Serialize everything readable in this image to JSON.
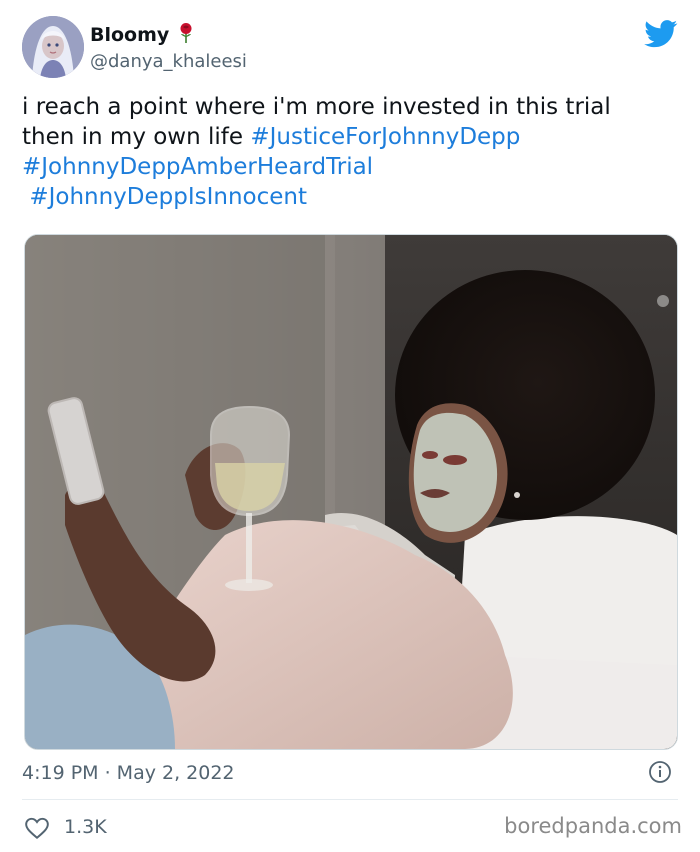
{
  "tweet": {
    "display_name": "Bloomy",
    "handle": "@danya_khaleesi",
    "text_lines": [
      {
        "plain": "i reach a point where i'm more invested in this trial",
        "tag": ""
      },
      {
        "plain": "then in my own life ",
        "tag": "#JusticeForJohnnyDepp"
      },
      {
        "plain": "",
        "tag": "#JohnnyDeppAmberHeardTrial"
      },
      {
        "plain": " ",
        "tag": "#JohnnyDeppIsInnocent"
      }
    ],
    "timestamp": "4:19 PM · May 2, 2022",
    "likes": "1.3K"
  },
  "branding": {
    "watermark": "boredpanda.com"
  },
  "icons": {
    "twitter": "twitter-bird-icon",
    "info": "info-icon",
    "like": "heart-icon",
    "emoji": "rose-icon"
  },
  "colors": {
    "hashtag": "#1d7ddb",
    "twitter_blue": "#1d9bf0",
    "secondary_text": "#536471"
  },
  "media": {
    "alt_description": ""
  }
}
